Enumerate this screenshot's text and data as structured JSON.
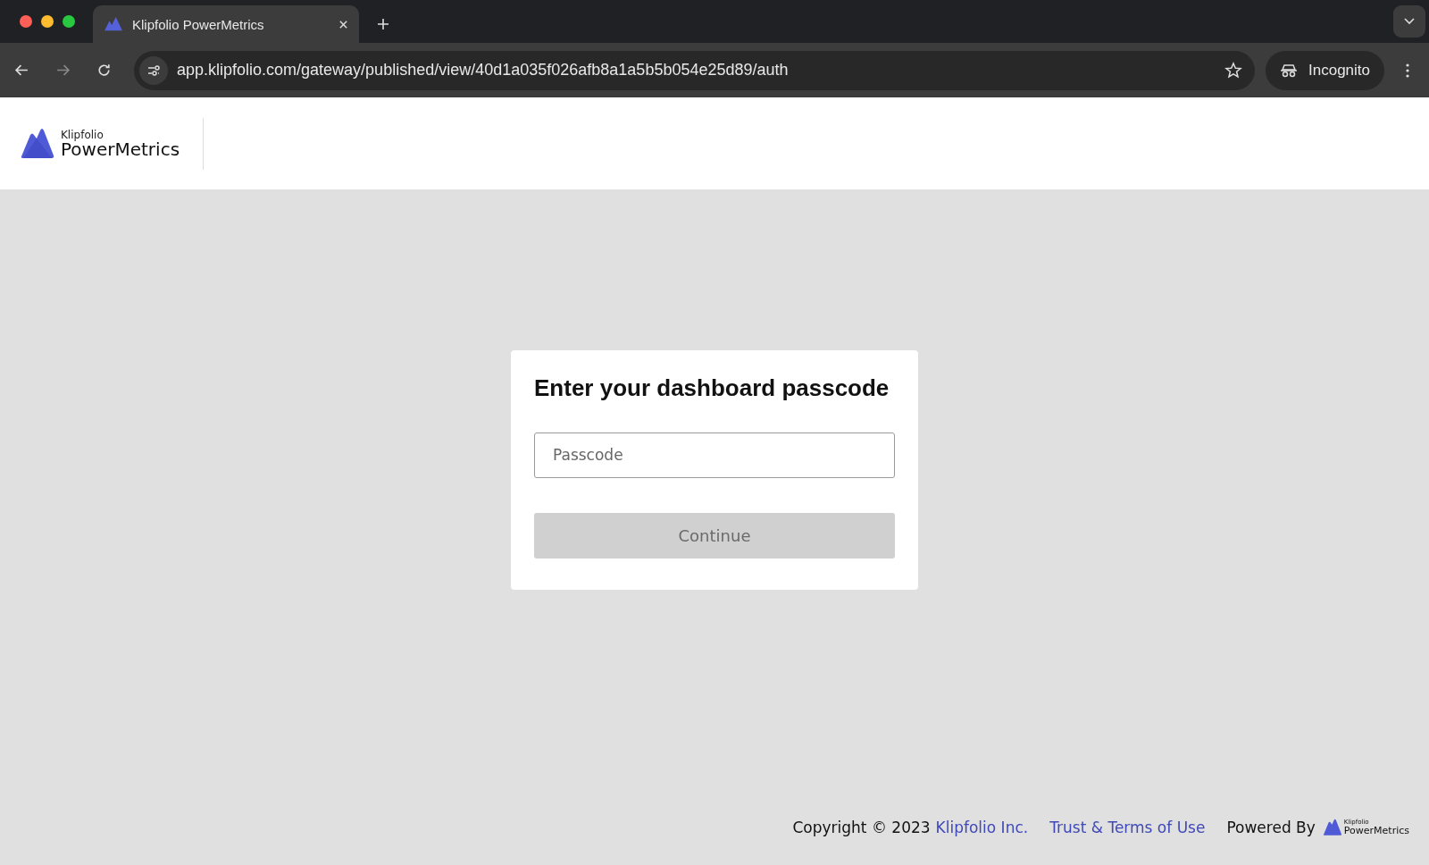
{
  "browser": {
    "tab": {
      "title": "Klipfolio PowerMetrics",
      "selected": true
    },
    "url": "app.klipfolio.com/gateway/published/view/40d1a035f026afb8a1a5b5b054e25d89/auth",
    "profile": "Incognito"
  },
  "header": {
    "logo_small": "Klipfolio",
    "logo_large": "PowerMetrics"
  },
  "card": {
    "title": "Enter your dashboard passcode",
    "passcode": {
      "placeholder": "Passcode"
    },
    "button": {
      "label": "Continue",
      "disabled": true
    }
  },
  "footer": {
    "copyright": "Copyright © 2023",
    "company_link": "Klipfolio Inc.",
    "terms_link": "Trust & Terms of Use",
    "powered_by": "Powered By",
    "logo_small": "Klipfolio",
    "logo_large": "PowerMetrics"
  }
}
